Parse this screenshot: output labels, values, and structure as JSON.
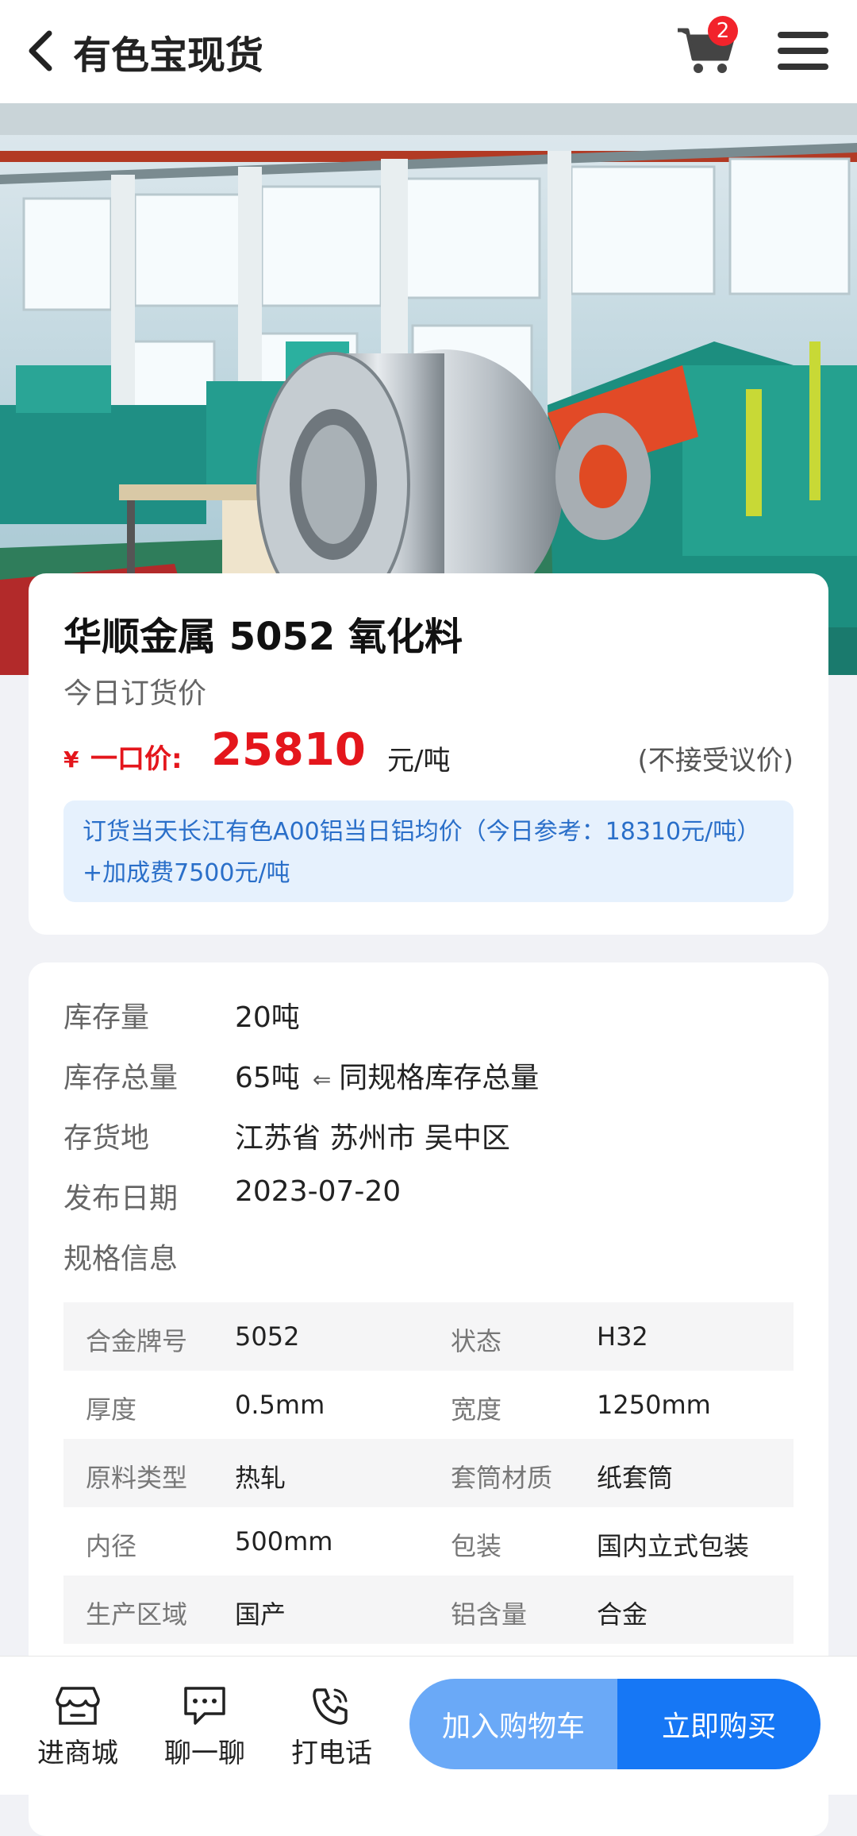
{
  "header": {
    "title": "有色宝现货",
    "cart_count": "2"
  },
  "product": {
    "title": "华顺金属 5052 氧化料",
    "price_subtitle": "今日订货价",
    "yen": "¥",
    "price_label": "一口价:",
    "price_value": "25810",
    "price_unit": "元/吨",
    "price_note": "(不接受议价)",
    "notice": "订货当天长江有色A00铝当日铝均价（今日参考：18310元/吨）+加成费7500元/吨"
  },
  "info": [
    {
      "label": "库存量",
      "value": "20吨"
    },
    {
      "label": "库存总量",
      "value": "65吨",
      "hint": "同规格库存总量"
    },
    {
      "label": "存货地",
      "value": "江苏省 苏州市 吴中区"
    },
    {
      "label": "发布日期",
      "value": "2023-07-20"
    },
    {
      "label": "规格信息",
      "value": ""
    }
  ],
  "specs": [
    [
      "合金牌号",
      "5052",
      "状态",
      "H32"
    ],
    [
      "厚度",
      "0.5mm",
      "宽度",
      "1250mm"
    ],
    [
      "原料类型",
      "热轧",
      "套筒材质",
      "纸套筒"
    ],
    [
      "内径",
      "500mm",
      "包装",
      "国内立式包装"
    ],
    [
      "生产区域",
      "国产",
      "铝含量",
      "合金"
    ]
  ],
  "bottom": {
    "store": "进商城",
    "chat": "聊一聊",
    "call": "打电话",
    "add_cart": "加入购物车",
    "buy_now": "立即购买"
  },
  "colors": {
    "price_red": "#e4161c",
    "accent_blue": "#1677f5",
    "light_blue": "#6aa9f7",
    "notice_bg": "#e6f1fd"
  }
}
